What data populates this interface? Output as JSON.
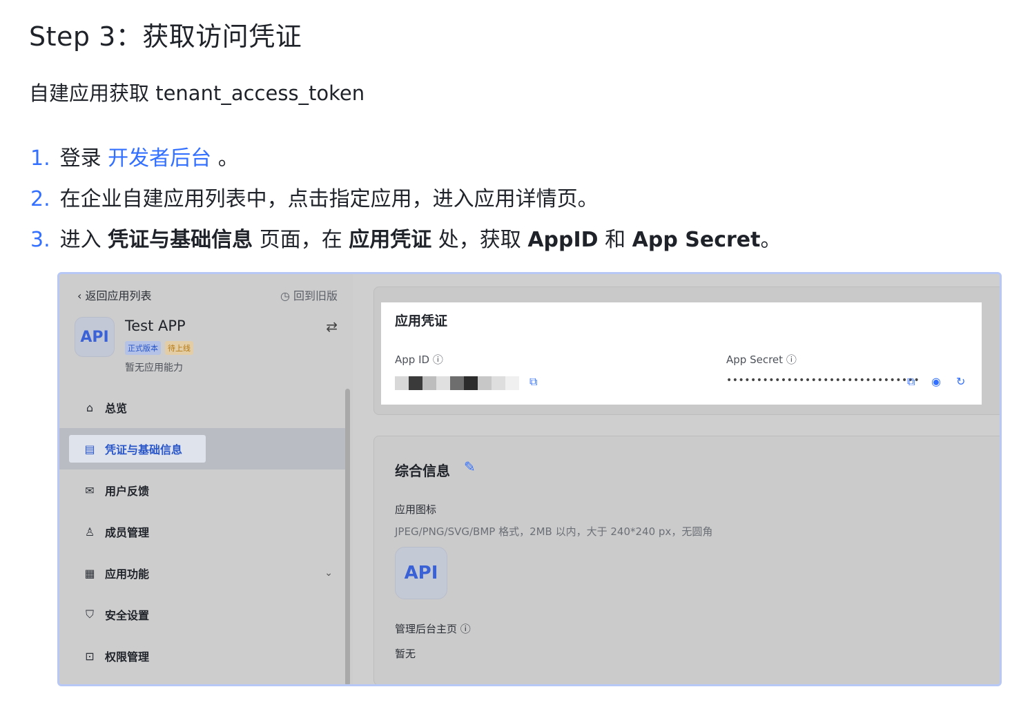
{
  "doc": {
    "title": "Step 3：获取访问凭证",
    "subtitle": "自建应用获取 tenant_access_token",
    "steps": [
      {
        "num": "1.",
        "pre": "登录 ",
        "link": "开发者后台",
        "post": " 。"
      },
      {
        "num": "2.",
        "text": "在企业自建应用列表中，点击指定应用，进入应用详情页。"
      },
      {
        "num": "3.",
        "p1": "进入 ",
        "b1": "凭证与基础信息",
        "p2": " 页面，在 ",
        "b2": "应用凭证",
        "p3": " 处，获取 ",
        "b3": "AppID",
        "p4": " 和 ",
        "b4": "App Secret",
        "p5": "。"
      }
    ]
  },
  "screenshot": {
    "sidebar": {
      "back": "返回应用列表",
      "old_version": "回到旧版",
      "app_avatar": "API",
      "app_name": "Test APP",
      "tag_release": "正式版本",
      "tag_pending": "待上线",
      "capability": "暂无应用能力",
      "items": [
        {
          "label": "总览",
          "icon": "home-icon"
        },
        {
          "label": "凭证与基础信息",
          "icon": "id-card-icon"
        },
        {
          "label": "用户反馈",
          "icon": "mail-icon"
        },
        {
          "label": "成员管理",
          "icon": "user-add-icon"
        },
        {
          "label": "应用功能",
          "icon": "grid-icon"
        },
        {
          "label": "安全设置",
          "icon": "shield-icon"
        },
        {
          "label": "权限管理",
          "icon": "briefcase-icon"
        }
      ]
    },
    "credentials": {
      "title": "应用凭证",
      "app_id_label": "App ID",
      "app_secret_label": "App Secret",
      "secret_dots": "••••••••••••••••••••••••••••••••"
    },
    "info": {
      "title": "综合信息",
      "icon_label": "应用图标",
      "icon_hint": "JPEG/PNG/SVG/BMP 格式，2MB 以内，大于 240*240 px，无圆角",
      "icon_text": "API",
      "home_label": "管理后台主页",
      "home_value": "暂无"
    }
  }
}
